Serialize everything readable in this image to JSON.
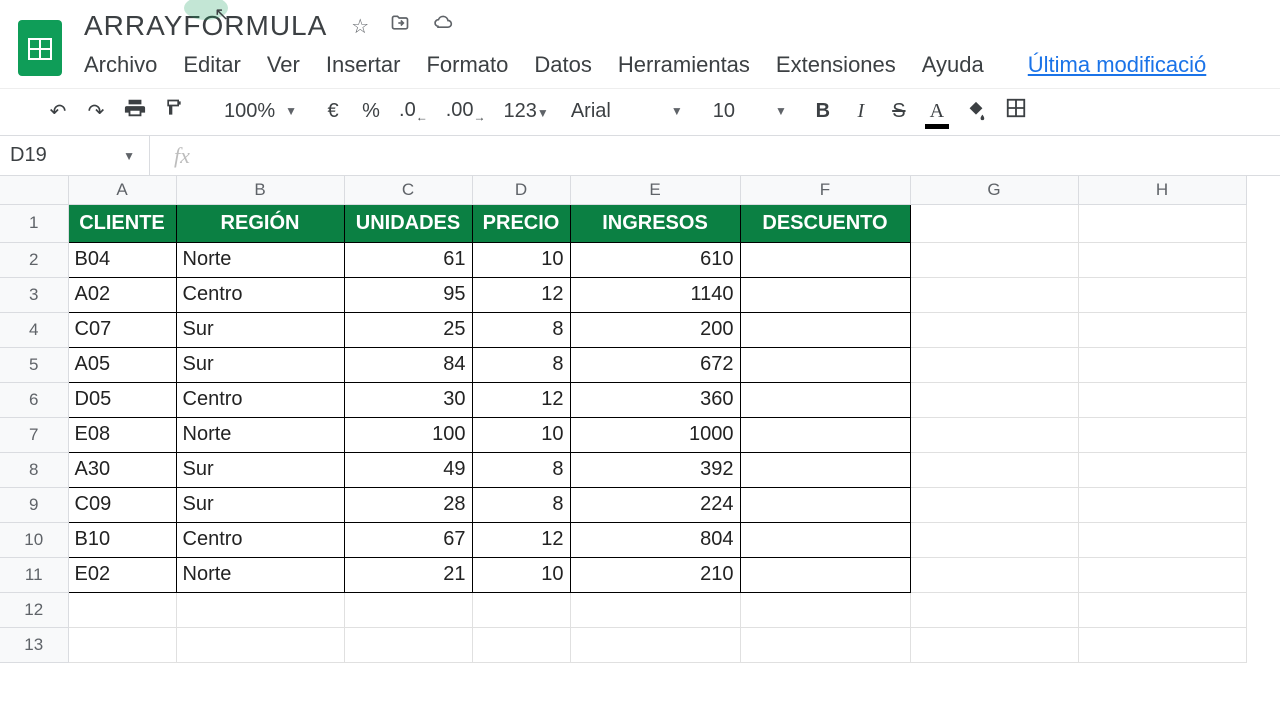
{
  "doc": {
    "title": "ARRAYFORMULA"
  },
  "menubar": {
    "archivo": "Archivo",
    "editar": "Editar",
    "ver": "Ver",
    "insertar": "Insertar",
    "formato": "Formato",
    "datos": "Datos",
    "herramientas": "Herramientas",
    "extensiones": "Extensiones",
    "ayuda": "Ayuda",
    "last_mod": "Última modificació"
  },
  "toolbar": {
    "zoom": "100%",
    "currency": "€",
    "percent": "%",
    "dec_less": ".0",
    "dec_more": ".00",
    "numfmt": "123",
    "font": "Arial",
    "size": "10",
    "bold": "B",
    "italic": "I",
    "strike": "S",
    "textcolor": "A"
  },
  "namebox": {
    "ref": "D19"
  },
  "fx": {
    "symbol": "fx"
  },
  "columns": [
    "A",
    "B",
    "C",
    "D",
    "E",
    "F",
    "G",
    "H"
  ],
  "col_widths": [
    "colA",
    "colB",
    "colC",
    "colD",
    "colE",
    "colF",
    "colG",
    "colH"
  ],
  "headers": {
    "a": "CLIENTE",
    "b": "REGIÓN",
    "c": "UNIDADES",
    "d": "PRECIO",
    "e": "INGRESOS",
    "f": "DESCUENTO"
  },
  "rows": [
    {
      "a": "B04",
      "b": "Norte",
      "c": "61",
      "d": "10",
      "e": "610",
      "f": ""
    },
    {
      "a": "A02",
      "b": "Centro",
      "c": "95",
      "d": "12",
      "e": "1140",
      "f": ""
    },
    {
      "a": "C07",
      "b": "Sur",
      "c": "25",
      "d": "8",
      "e": "200",
      "f": ""
    },
    {
      "a": "A05",
      "b": "Sur",
      "c": "84",
      "d": "8",
      "e": "672",
      "f": ""
    },
    {
      "a": "D05",
      "b": "Centro",
      "c": "30",
      "d": "12",
      "e": "360",
      "f": ""
    },
    {
      "a": "E08",
      "b": "Norte",
      "c": "100",
      "d": "10",
      "e": "1000",
      "f": ""
    },
    {
      "a": "A30",
      "b": "Sur",
      "c": "49",
      "d": "8",
      "e": "392",
      "f": ""
    },
    {
      "a": "C09",
      "b": "Sur",
      "c": "28",
      "d": "8",
      "e": "224",
      "f": ""
    },
    {
      "a": "B10",
      "b": "Centro",
      "c": "67",
      "d": "12",
      "e": "804",
      "f": ""
    },
    {
      "a": "E02",
      "b": "Norte",
      "c": "21",
      "d": "10",
      "e": "210",
      "f": ""
    }
  ],
  "empty_rows": [
    "12",
    "13"
  ]
}
